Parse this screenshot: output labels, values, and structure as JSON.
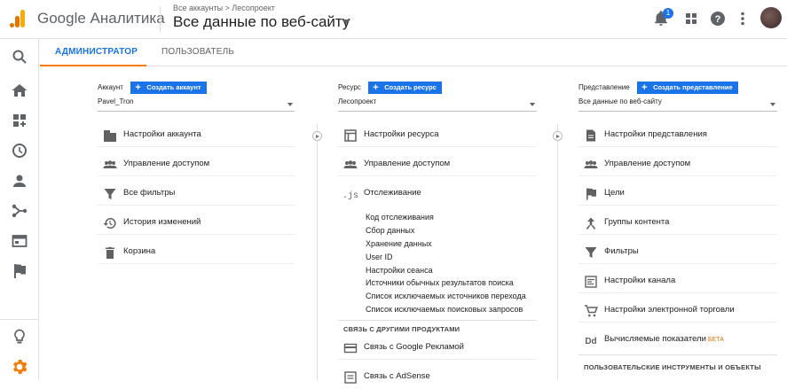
{
  "header": {
    "app_name": "Google Аналитика",
    "breadcrumb": "Все аккаунты > Лесопроект",
    "view_title": "Все данные по веб-сайту",
    "notification_count": "1"
  },
  "tabs": {
    "admin": "АДМИНИСТРАТОР",
    "user": "ПОЛЬЗОВАТЕЛЬ"
  },
  "account": {
    "label": "Аккаунт",
    "create_button": "Создать аккаунт",
    "selected": "Pavel_Tron",
    "items": [
      "Настройки аккаунта",
      "Управление доступом",
      "Все фильтры",
      "История изменений",
      "Корзина"
    ]
  },
  "property": {
    "label": "Ресурс",
    "create_button": "Создать ресурс",
    "selected": "Лесопроект",
    "items": [
      "Настройки ресурса",
      "Управление доступом",
      "Отслеживание"
    ],
    "tracking_subitems": [
      "Код отслеживания",
      "Сбор данных",
      "Хранение данных",
      "User ID",
      "Настройки сеанса",
      "Источники обычных результатов поиска",
      "Список исключаемых источников перехода",
      "Список исключаемых поисковых запросов"
    ],
    "linking_section": "СВЯЗЬ С ДРУГИМИ ПРОДУКТАМИ",
    "linking_items": [
      "Связь с Google Рекламой",
      "Связь с AdSense"
    ]
  },
  "view": {
    "label": "Представление",
    "create_button": "Создать представление",
    "selected": "Все данные по веб-сайту",
    "items": [
      "Настройки представления",
      "Управление доступом",
      "Цели",
      "Группы контента",
      "Фильтры",
      "Настройки канала",
      "Настройки электронной торговли",
      "Вычисляемые показатели"
    ],
    "beta_badge": "БЕТА",
    "tools_section": "ПОЛЬЗОВАТЕЛЬСКИЕ ИНСТРУМЕНТЫ И ОБЪЕКТЫ"
  },
  "colors": {
    "accent": "#1a73e8",
    "tab_underline": "#f57c00",
    "settings_icon": "#f57c00"
  }
}
